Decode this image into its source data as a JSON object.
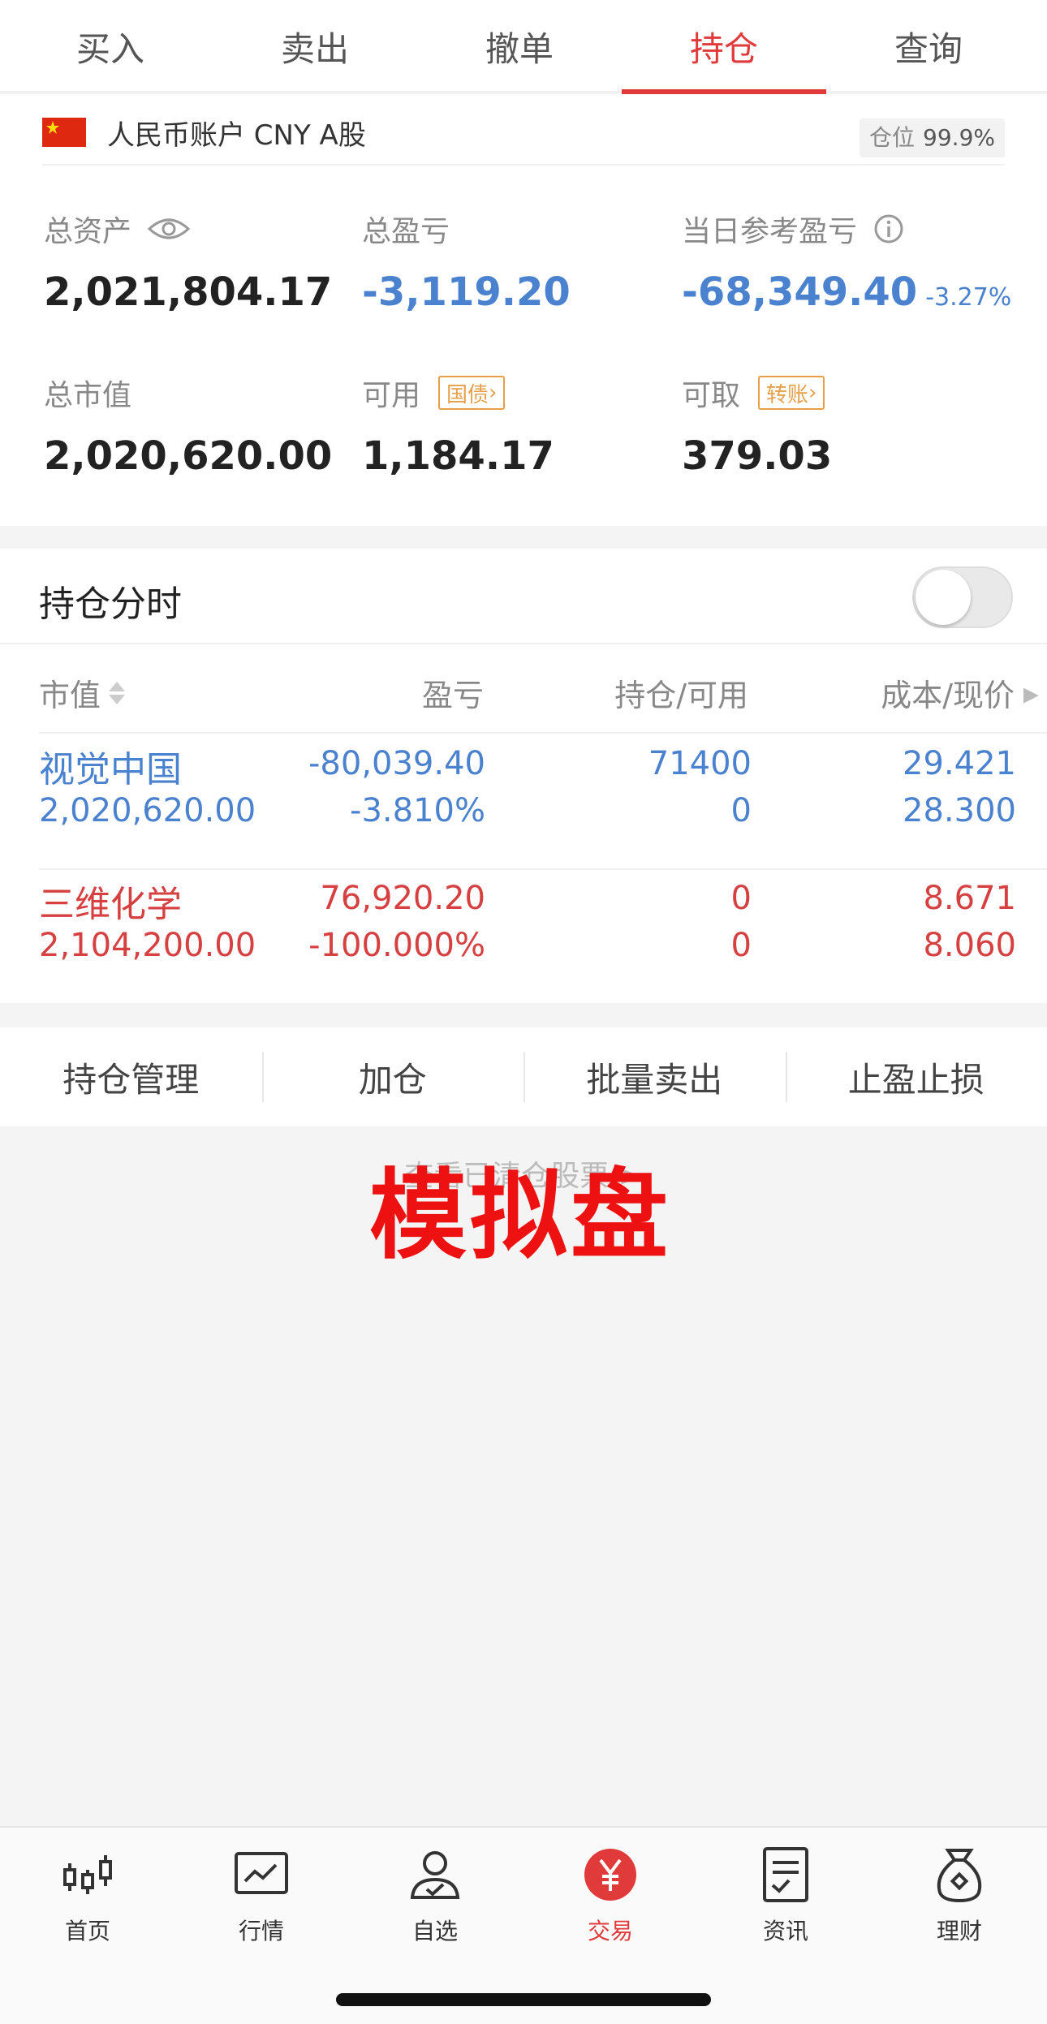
{
  "tabs": [
    {
      "label": "买入"
    },
    {
      "label": "卖出"
    },
    {
      "label": "撤单"
    },
    {
      "label": "持仓"
    },
    {
      "label": "查询"
    }
  ],
  "active_tab": "持仓",
  "account": {
    "name": "人民币账户 CNY A股",
    "position_label": "仓位",
    "position_value": "99.9%"
  },
  "summary": {
    "total_assets_label": "总资产",
    "total_assets": "2,021,804.17",
    "total_pl_label": "总盈亏",
    "total_pl": "-3,119.20",
    "daily_pl_label": "当日参考盈亏",
    "daily_pl": "-68,349.40",
    "daily_pl_pct": "-3.27%",
    "market_value_label": "总市值",
    "market_value": "2,020,620.00",
    "available_label": "可用",
    "available": "1,184.17",
    "bond_tag": "国债",
    "withdrawable_label": "可取",
    "withdrawable": "379.03",
    "transfer_tag": "转账"
  },
  "holdings": {
    "section_title": "持仓分时",
    "toggle_on": false,
    "columns": {
      "market_value": "市值",
      "pl": "盈亏",
      "position": "持仓/可用",
      "cost_price": "成本/现价"
    },
    "rows": [
      {
        "name": "视觉中国",
        "market_value": "2,020,620.00",
        "pl": "-80,039.40",
        "pl_pct": "-3.810%",
        "position": "71400",
        "available": "0",
        "cost": "29.421",
        "price": "28.300",
        "color": "#4a82cf"
      },
      {
        "name": "三维化学",
        "market_value": "2,104,200.00",
        "pl": "76,920.20",
        "pl_pct": "-100.000%",
        "position": "0",
        "available": "0",
        "cost": "8.671",
        "price": "8.060",
        "color": "#d64040"
      }
    ]
  },
  "actions": [
    {
      "label": "持仓管理"
    },
    {
      "label": "加仓"
    },
    {
      "label": "批量卖出"
    },
    {
      "label": "止盈止损"
    }
  ],
  "hint_text": "查看已清仓股票 >",
  "watermark": "模拟盘",
  "bottom_nav": [
    {
      "label": "首页",
      "icon": "candlestick-icon"
    },
    {
      "label": "行情",
      "icon": "chart-icon"
    },
    {
      "label": "自选",
      "icon": "user-check-icon"
    },
    {
      "label": "交易",
      "icon": "yuan-icon"
    },
    {
      "label": "资讯",
      "icon": "document-icon"
    },
    {
      "label": "理财",
      "icon": "money-bag-icon"
    }
  ],
  "active_nav": "交易",
  "colors": {
    "accent": "#e03a3a",
    "loss_blue": "#4a82cf",
    "gain_red": "#d64040",
    "tag_orange": "#e6a04a"
  }
}
